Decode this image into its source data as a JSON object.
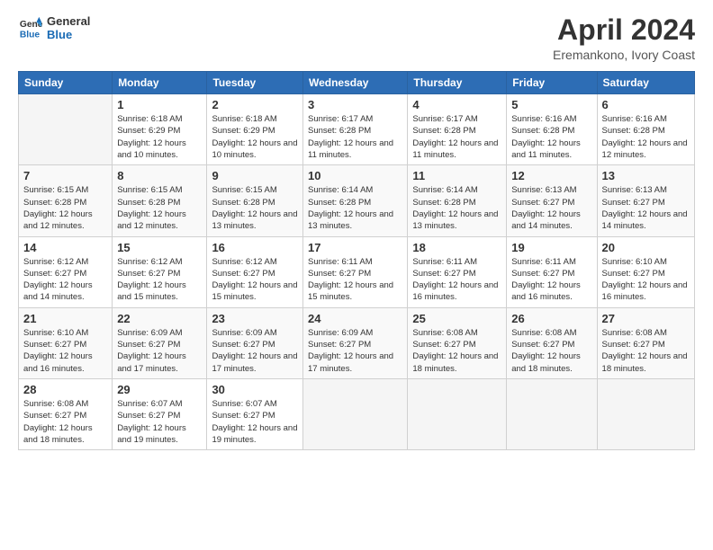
{
  "logo": {
    "line1": "General",
    "line2": "Blue"
  },
  "title": "April 2024",
  "subtitle": "Eremankono, Ivory Coast",
  "days_header": [
    "Sunday",
    "Monday",
    "Tuesday",
    "Wednesday",
    "Thursday",
    "Friday",
    "Saturday"
  ],
  "weeks": [
    [
      {
        "day": "",
        "sunrise": "",
        "sunset": "",
        "daylight": ""
      },
      {
        "day": "1",
        "sunrise": "Sunrise: 6:18 AM",
        "sunset": "Sunset: 6:29 PM",
        "daylight": "Daylight: 12 hours and 10 minutes."
      },
      {
        "day": "2",
        "sunrise": "Sunrise: 6:18 AM",
        "sunset": "Sunset: 6:29 PM",
        "daylight": "Daylight: 12 hours and 10 minutes."
      },
      {
        "day": "3",
        "sunrise": "Sunrise: 6:17 AM",
        "sunset": "Sunset: 6:28 PM",
        "daylight": "Daylight: 12 hours and 11 minutes."
      },
      {
        "day": "4",
        "sunrise": "Sunrise: 6:17 AM",
        "sunset": "Sunset: 6:28 PM",
        "daylight": "Daylight: 12 hours and 11 minutes."
      },
      {
        "day": "5",
        "sunrise": "Sunrise: 6:16 AM",
        "sunset": "Sunset: 6:28 PM",
        "daylight": "Daylight: 12 hours and 11 minutes."
      },
      {
        "day": "6",
        "sunrise": "Sunrise: 6:16 AM",
        "sunset": "Sunset: 6:28 PM",
        "daylight": "Daylight: 12 hours and 12 minutes."
      }
    ],
    [
      {
        "day": "7",
        "sunrise": "Sunrise: 6:15 AM",
        "sunset": "Sunset: 6:28 PM",
        "daylight": "Daylight: 12 hours and 12 minutes."
      },
      {
        "day": "8",
        "sunrise": "Sunrise: 6:15 AM",
        "sunset": "Sunset: 6:28 PM",
        "daylight": "Daylight: 12 hours and 12 minutes."
      },
      {
        "day": "9",
        "sunrise": "Sunrise: 6:15 AM",
        "sunset": "Sunset: 6:28 PM",
        "daylight": "Daylight: 12 hours and 13 minutes."
      },
      {
        "day": "10",
        "sunrise": "Sunrise: 6:14 AM",
        "sunset": "Sunset: 6:28 PM",
        "daylight": "Daylight: 12 hours and 13 minutes."
      },
      {
        "day": "11",
        "sunrise": "Sunrise: 6:14 AM",
        "sunset": "Sunset: 6:28 PM",
        "daylight": "Daylight: 12 hours and 13 minutes."
      },
      {
        "day": "12",
        "sunrise": "Sunrise: 6:13 AM",
        "sunset": "Sunset: 6:27 PM",
        "daylight": "Daylight: 12 hours and 14 minutes."
      },
      {
        "day": "13",
        "sunrise": "Sunrise: 6:13 AM",
        "sunset": "Sunset: 6:27 PM",
        "daylight": "Daylight: 12 hours and 14 minutes."
      }
    ],
    [
      {
        "day": "14",
        "sunrise": "Sunrise: 6:12 AM",
        "sunset": "Sunset: 6:27 PM",
        "daylight": "Daylight: 12 hours and 14 minutes."
      },
      {
        "day": "15",
        "sunrise": "Sunrise: 6:12 AM",
        "sunset": "Sunset: 6:27 PM",
        "daylight": "Daylight: 12 hours and 15 minutes."
      },
      {
        "day": "16",
        "sunrise": "Sunrise: 6:12 AM",
        "sunset": "Sunset: 6:27 PM",
        "daylight": "Daylight: 12 hours and 15 minutes."
      },
      {
        "day": "17",
        "sunrise": "Sunrise: 6:11 AM",
        "sunset": "Sunset: 6:27 PM",
        "daylight": "Daylight: 12 hours and 15 minutes."
      },
      {
        "day": "18",
        "sunrise": "Sunrise: 6:11 AM",
        "sunset": "Sunset: 6:27 PM",
        "daylight": "Daylight: 12 hours and 16 minutes."
      },
      {
        "day": "19",
        "sunrise": "Sunrise: 6:11 AM",
        "sunset": "Sunset: 6:27 PM",
        "daylight": "Daylight: 12 hours and 16 minutes."
      },
      {
        "day": "20",
        "sunrise": "Sunrise: 6:10 AM",
        "sunset": "Sunset: 6:27 PM",
        "daylight": "Daylight: 12 hours and 16 minutes."
      }
    ],
    [
      {
        "day": "21",
        "sunrise": "Sunrise: 6:10 AM",
        "sunset": "Sunset: 6:27 PM",
        "daylight": "Daylight: 12 hours and 16 minutes."
      },
      {
        "day": "22",
        "sunrise": "Sunrise: 6:09 AM",
        "sunset": "Sunset: 6:27 PM",
        "daylight": "Daylight: 12 hours and 17 minutes."
      },
      {
        "day": "23",
        "sunrise": "Sunrise: 6:09 AM",
        "sunset": "Sunset: 6:27 PM",
        "daylight": "Daylight: 12 hours and 17 minutes."
      },
      {
        "day": "24",
        "sunrise": "Sunrise: 6:09 AM",
        "sunset": "Sunset: 6:27 PM",
        "daylight": "Daylight: 12 hours and 17 minutes."
      },
      {
        "day": "25",
        "sunrise": "Sunrise: 6:08 AM",
        "sunset": "Sunset: 6:27 PM",
        "daylight": "Daylight: 12 hours and 18 minutes."
      },
      {
        "day": "26",
        "sunrise": "Sunrise: 6:08 AM",
        "sunset": "Sunset: 6:27 PM",
        "daylight": "Daylight: 12 hours and 18 minutes."
      },
      {
        "day": "27",
        "sunrise": "Sunrise: 6:08 AM",
        "sunset": "Sunset: 6:27 PM",
        "daylight": "Daylight: 12 hours and 18 minutes."
      }
    ],
    [
      {
        "day": "28",
        "sunrise": "Sunrise: 6:08 AM",
        "sunset": "Sunset: 6:27 PM",
        "daylight": "Daylight: 12 hours and 18 minutes."
      },
      {
        "day": "29",
        "sunrise": "Sunrise: 6:07 AM",
        "sunset": "Sunset: 6:27 PM",
        "daylight": "Daylight: 12 hours and 19 minutes."
      },
      {
        "day": "30",
        "sunrise": "Sunrise: 6:07 AM",
        "sunset": "Sunset: 6:27 PM",
        "daylight": "Daylight: 12 hours and 19 minutes."
      },
      {
        "day": "",
        "sunrise": "",
        "sunset": "",
        "daylight": ""
      },
      {
        "day": "",
        "sunrise": "",
        "sunset": "",
        "daylight": ""
      },
      {
        "day": "",
        "sunrise": "",
        "sunset": "",
        "daylight": ""
      },
      {
        "day": "",
        "sunrise": "",
        "sunset": "",
        "daylight": ""
      }
    ]
  ]
}
